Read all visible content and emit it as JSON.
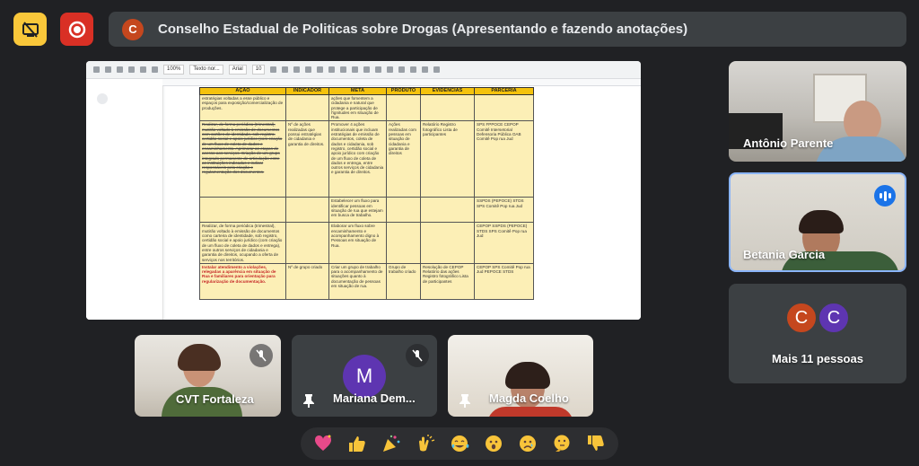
{
  "meeting": {
    "title": "Conselho Estadual de Politicas sobre Drogas (Apresentando e fazendo anotações)",
    "presenter_initial": "C"
  },
  "toolbar": {
    "zoom": "100%",
    "style": "Texto nor...",
    "font": "Arial",
    "font_size": "10"
  },
  "table": {
    "headers": [
      "AÇÃO",
      "INDICADOR",
      "META",
      "PRODUTO",
      "EVIDÊNCIAS",
      "PARCERIA"
    ],
    "rows": [
      [
        "estratégias voltadas a esse público e espaços para exposição/comercialização de produções.",
        "",
        "ações que fomentem a cidadania e natural que protege a participação de l'ignitudes em situação de Rua.",
        "",
        "",
        ""
      ],
      [
        "Realizar, de forma periódica (trimestral), mutirão voltado à emissão de documentos com cartões de identidade, sob registro, certidão social e apoio jurídico (com criação de um fluxo de coleta de dados e encaminhamento. Aprimorar as etapas de acesso aos serviços. Criação de um grupo integrado permanente de articulação entre as instituições indicadas e indicar responsáveis pela criação e regulamentação dos documentos.",
        "Nº de ações realizadas que possui estratégias de cidadania e garantia de direitos.",
        "Promover 4 ações institucionais que incluam estratégias de emissão de documentos, coleta de dados e cidadania, sob registro, certidão social e apoio jurídico com criação de um fluxo de coleta de dados e entrega, entre outros serviços de cidadania e garantia de direitos.",
        "Ações realizadas com pessoas em situação de cidadania e garantia de direitos",
        "Relatório Registro fotográfico Lista de participantes",
        "SPS FPPOCE CEPOP Comitê Intersetorial Defensoria Pública OAB Comitê Pop rua Jud"
      ],
      [
        "",
        "",
        "Estabelecer um fluxo para identificar pessoas em situação de rua que estejam em busca de trabalho.",
        "",
        "",
        "SSPDS (PEPOCE) STDS SPS Comitê Pop rua Jud"
      ],
      [
        "Realizar, de forma periódica (trimestral), mutirão voltado à emissão de documentos como carteira de identidade, sob registro, certidão social e apoio jurídico (com criação de um fluxo de coleta de dados e entrega), entre outros serviços de cidadania e garantia de direitos, ocupando a oferta de serviços nos territórios.",
        "",
        "Elaborar um fluxo sobre encaminhamento e acompanhamento digno à Pessoas em situação de Rua.",
        "",
        "",
        "CEPOP SSPDS (PEPOCE) STDS SPS Comitê Pop rua Jud"
      ],
      [
        "Instalar atendimento a violações, relegadas a aparência em situação de Rua e familiares para orientação para regularização de documentação.",
        "Nº de grupo criado",
        "Criar um grupo de trabalho para o acompanhamento de situações quanto à documentação de pessoas em situação de rua.",
        "Grupo de trabalho criado",
        "Resolução de CEPOP Relatório das ações Registro fotográfico Lista de participantes",
        "CEPOP SPS Comitê Pop rua Jud PEPOCE STDS"
      ]
    ]
  },
  "participants": {
    "antonio": {
      "name": "Antônio Parente"
    },
    "betania": {
      "name": "Betania Garcia"
    },
    "more": {
      "label": "Mais 11 pessoas",
      "avatar1": "C",
      "avatar2": "C"
    },
    "cvt": {
      "name": "CVT Fortaleza"
    },
    "mariana": {
      "name": "Mariana Dem...",
      "initial": "M"
    },
    "magda": {
      "name": "Magda Coelho"
    }
  },
  "colors": {
    "background": "#202124",
    "presenting_badge": "#f9c73a",
    "recording_badge": "#d93025",
    "speaking_ring": "#8ab4f8",
    "table_header": "#f4c20d",
    "table_cell": "#fcefb6",
    "avatar_orange": "#c5471e",
    "avatar_purple": "#5e35b1"
  },
  "reactions": [
    "sparkling-heart",
    "thumbs-up",
    "party-popper",
    "clapping-hands",
    "tears-of-joy",
    "surprised-face",
    "crying-face",
    "thinking-face",
    "thumbs-down"
  ]
}
